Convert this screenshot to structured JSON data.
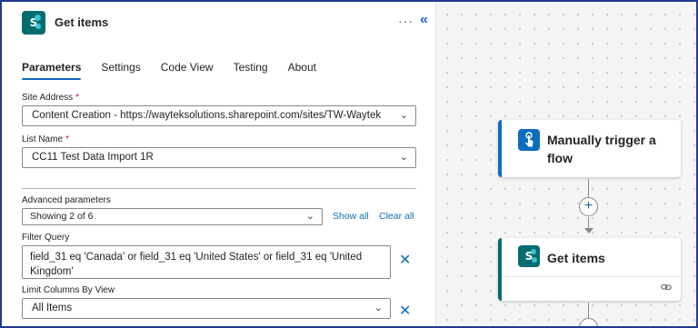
{
  "panel": {
    "title": "Get items",
    "more_label": "···",
    "collapse_label": "«",
    "tabs": [
      {
        "label": "Parameters",
        "active": true
      },
      {
        "label": "Settings",
        "active": false
      },
      {
        "label": "Code View",
        "active": false
      },
      {
        "label": "Testing",
        "active": false
      },
      {
        "label": "About",
        "active": false
      }
    ],
    "site_address": {
      "label": "Site Address",
      "required_mark": "*",
      "value": "Content Creation - https://wayteksolutions.sharepoint.com/sites/TW-Waytek"
    },
    "list_name": {
      "label": "List Name",
      "required_mark": "*",
      "value": "CC11 Test Data Import 1R"
    },
    "advanced": {
      "label": "Advanced parameters",
      "value": "Showing 2 of 6",
      "show_all": "Show all",
      "clear_all": "Clear all"
    },
    "filter_query": {
      "label": "Filter Query",
      "value": "field_31 eq 'Canada' or field_31 eq 'United States' or field_31 eq 'United Kingdom'"
    },
    "limit_columns": {
      "label": "Limit Columns By View",
      "value": "All Items"
    }
  },
  "canvas": {
    "trigger_card": {
      "title": "Manually trigger a flow",
      "icon": "touch-icon"
    },
    "get_items_card": {
      "title": "Get items",
      "icon": "sharepoint-icon"
    }
  },
  "colors": {
    "accent": "#0f6cbd",
    "sharepoint": "#036c70",
    "required": "#c50f1f"
  }
}
